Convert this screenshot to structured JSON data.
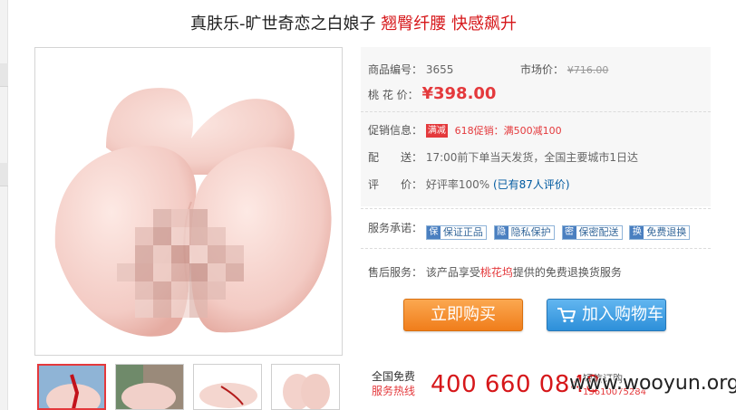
{
  "product": {
    "title_main": "真肤乐-旷世奇恋之白娘子",
    "title_highlight": "翘臀纤腰 快感飙升"
  },
  "info": {
    "sku_label": "商品编号：",
    "sku_value": "3655",
    "market_label": "市场价：",
    "market_value": "¥716.00",
    "price_label": "桃 花 价：",
    "price_value": "¥398.00",
    "promo_label": "促销信息：",
    "promo_tag": "满减",
    "promo_text": "618促销：满500减100",
    "delivery_label": "配　　送：",
    "delivery_text": "17:00前下单当天发货，全国主要城市1日达",
    "rating_label": "评　　价：",
    "rating_text": "好评率100%",
    "rating_link": "(已有87人评价)"
  },
  "services": {
    "label": "服务承诺：",
    "items": [
      {
        "icon": "保",
        "text": "保证正品"
      },
      {
        "icon": "隐",
        "text": "隐私保护"
      },
      {
        "icon": "密",
        "text": "保密配送"
      },
      {
        "icon": "换",
        "text": "免费退换"
      }
    ]
  },
  "aftersale": {
    "label": "售后服务：",
    "prefix": "该产品享受",
    "shop": "桃花坞",
    "suffix": "提供的免费退换货服务"
  },
  "buttons": {
    "buy": "立即购买",
    "cart": "加入购物车"
  },
  "hotline": {
    "line1": "全国免费",
    "line2": "服务热线",
    "number": "400 660 0848",
    "sms_label": "短信订购",
    "sms_number": "13610075284"
  },
  "watermark": "www.wooyun.org",
  "colors": {
    "accent_red": "#e4393c",
    "buy_orange": "#f07d1b",
    "cart_blue": "#2d8fd9"
  }
}
